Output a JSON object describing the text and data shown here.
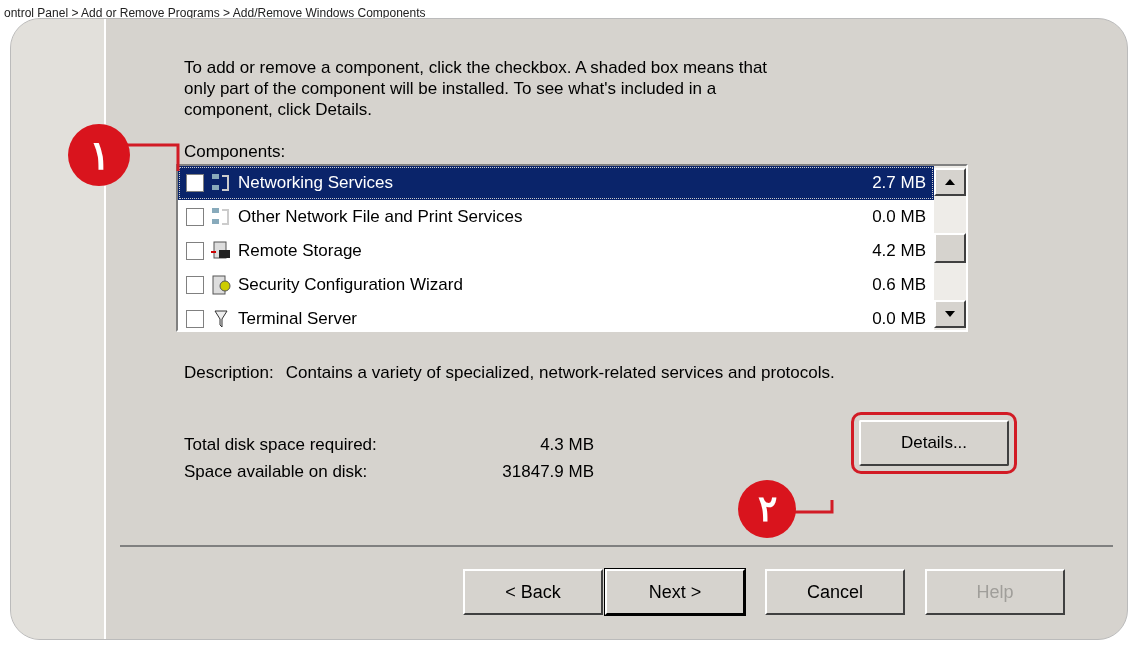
{
  "breadcrumb": "ontrol Panel > Add or Remove Programs > Add/Remove Windows Components",
  "instructions": "To add or remove a component, click the checkbox.  A shaded box means that only part of the component will be installed.  To see what's included in a component, click Details.",
  "components_label": "Components:",
  "components": [
    {
      "name": "Networking Services",
      "size": "2.7 MB",
      "checked": false,
      "selected": true,
      "kind": "network"
    },
    {
      "name": "Other Network File and Print Services",
      "size": "0.0 MB",
      "checked": false,
      "selected": false,
      "kind": "network"
    },
    {
      "name": "Remote Storage",
      "size": "4.2 MB",
      "checked": false,
      "selected": false,
      "kind": "storage"
    },
    {
      "name": "Security Configuration Wizard",
      "size": "0.6 MB",
      "checked": false,
      "selected": false,
      "kind": "security"
    },
    {
      "name": "Terminal Server",
      "size": "0.0 MB",
      "checked": false,
      "selected": false,
      "kind": "terminal"
    }
  ],
  "description_label": "Description:",
  "description": "Contains a variety of specialized, network-related services and protocols.",
  "disk": [
    {
      "label": "Total disk space required:",
      "value": "4.3 MB"
    },
    {
      "label": "Space available on disk:",
      "value": "31847.9 MB"
    }
  ],
  "details_button": "Details...",
  "buttons": [
    {
      "label": "< Back",
      "default": false,
      "disabled": false
    },
    {
      "label": "Next >",
      "default": true,
      "disabled": false
    },
    {
      "label": "Cancel",
      "default": false,
      "disabled": false
    },
    {
      "label": "Help",
      "default": false,
      "disabled": true
    }
  ],
  "callouts": [
    "۱",
    "۲"
  ]
}
